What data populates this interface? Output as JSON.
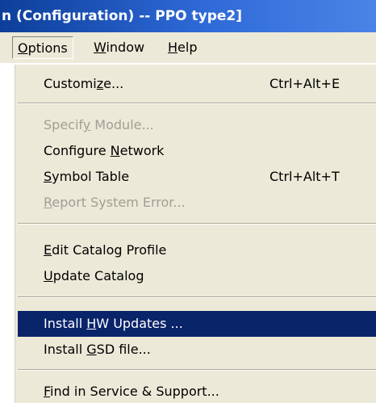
{
  "window": {
    "title": "n (Configuration) -- PPO type2]"
  },
  "menubar": {
    "items": [
      {
        "label_underlined": "O",
        "label_rest": "ptions"
      },
      {
        "label_underlined": "W",
        "label_rest": "indow"
      },
      {
        "label_underlined": "H",
        "label_rest": "elp"
      }
    ]
  },
  "dropdown": {
    "items": [
      {
        "pre": "Customi",
        "u": "z",
        "post": "e...",
        "shortcut": "Ctrl+Alt+E",
        "enabled": true
      },
      {
        "pre": "Specif",
        "u": "y",
        "post": " Module...",
        "shortcut": "",
        "enabled": false
      },
      {
        "pre": "Configure ",
        "u": "N",
        "post": "etwork",
        "shortcut": "",
        "enabled": true
      },
      {
        "pre": "",
        "u": "S",
        "post": "ymbol Table",
        "shortcut": "Ctrl+Alt+T",
        "enabled": true
      },
      {
        "pre": "",
        "u": "R",
        "post": "eport System Error...",
        "shortcut": "",
        "enabled": false
      },
      {
        "pre": "",
        "u": "E",
        "post": "dit Catalog Profile",
        "shortcut": "",
        "enabled": true
      },
      {
        "pre": "",
        "u": "U",
        "post": "pdate Catalog",
        "shortcut": "",
        "enabled": true
      },
      {
        "pre": "Install ",
        "u": "H",
        "post": "W Updates ...",
        "shortcut": "",
        "enabled": true,
        "highlighted": true
      },
      {
        "pre": "Install ",
        "u": "G",
        "post": "SD file...",
        "shortcut": "",
        "enabled": true
      },
      {
        "pre": "",
        "u": "F",
        "post": "ind in Service & Support...",
        "shortcut": "",
        "enabled": true
      }
    ]
  },
  "colors": {
    "menu_background": "#ece9d8",
    "highlight": "#0a246a",
    "titlebar": "#2f6ad8",
    "disabled_text": "#a19f94"
  }
}
